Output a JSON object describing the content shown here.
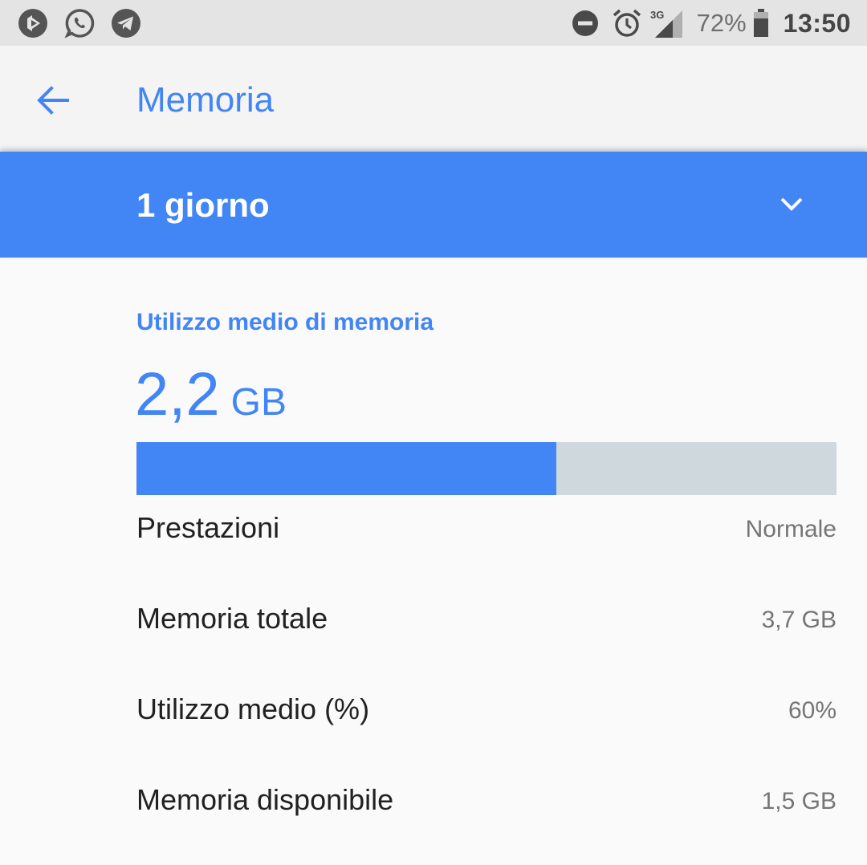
{
  "status_bar": {
    "notification_icons": [
      "media-icon",
      "whatsapp-icon",
      "telegram-icon"
    ],
    "status_icons": [
      "dnd-icon",
      "alarm-icon",
      "signal-3g-icon",
      "battery-icon"
    ],
    "network_label": "3G",
    "battery_percent": "72%",
    "time": "13:50"
  },
  "app_bar": {
    "title": "Memoria"
  },
  "period_selector": {
    "selected": "1 giorno"
  },
  "memory_usage": {
    "header": "Utilizzo medio di memoria",
    "value": "2,2",
    "unit": "GB",
    "usage_fraction": 0.6
  },
  "details": [
    {
      "label": "Prestazioni",
      "value": "Normale"
    },
    {
      "label": "Memoria totale",
      "value": "3,7 GB"
    },
    {
      "label": "Utilizzo medio (%)",
      "value": "60%"
    },
    {
      "label": "Memoria disponibile",
      "value": "1,5 GB"
    }
  ],
  "colors": {
    "accent": "#4285f4",
    "track": "#cfd8dc",
    "status_bar_bg": "#e4e4e4",
    "app_bar_bg": "#f4f4f4"
  }
}
